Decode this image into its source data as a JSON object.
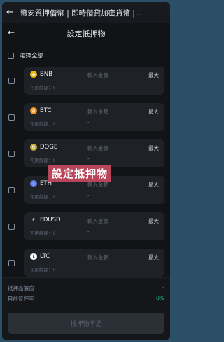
{
  "topbar": {
    "title": "幣安質押借幣 | 即時借貸加密貨幣 |..."
  },
  "sheet": {
    "title": "設定抵押物"
  },
  "select_all": {
    "label": "選擇全部"
  },
  "overlay": {
    "text": "設定抵押物"
  },
  "common": {
    "available_label": "可用餘額：0",
    "amount_placeholder": "輸入金額",
    "max_label": "最大",
    "dash": "-"
  },
  "assets": [
    {
      "symbol": "BNB",
      "icon_color": "#f0b90b",
      "icon_glyph": "◆"
    },
    {
      "symbol": "BTC",
      "icon_color": "#f7931a",
      "icon_glyph": "₿"
    },
    {
      "symbol": "DOGE",
      "icon_color": "#c2a633",
      "icon_glyph": "Ð"
    },
    {
      "symbol": "ETH",
      "icon_color": "#627eea",
      "icon_glyph": "◊"
    },
    {
      "symbol": "FDUSD",
      "icon_color": "#1e2126",
      "icon_glyph": "F"
    },
    {
      "symbol": "LTC",
      "icon_color": "#ffffff",
      "icon_glyph": "Ł"
    }
  ],
  "footer": {
    "collateral_value_label": "抵押品價值",
    "collateral_value": "-",
    "current_ltv_label": "目前質押率",
    "current_ltv": "0%",
    "submit_label": "抵押物不足"
  }
}
